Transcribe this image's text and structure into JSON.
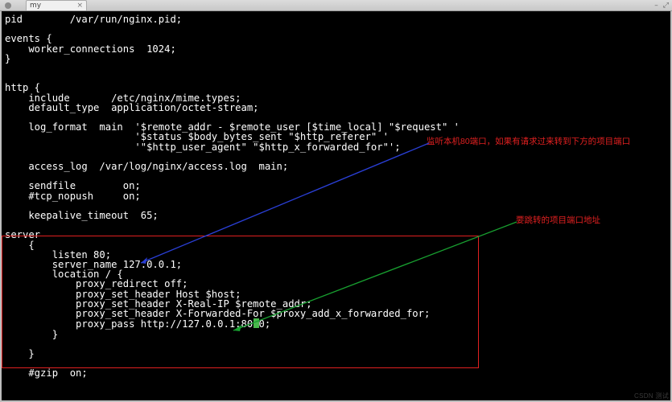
{
  "window": {
    "tab_title": "my",
    "close_glyph": "×",
    "right_icons": [
      "–",
      "⤢"
    ]
  },
  "code": {
    "l01": "pid        /var/run/nginx.pid;",
    "l02": "",
    "l03": "events {",
    "l04": "    worker_connections  1024;",
    "l05": "}",
    "l06": "",
    "l07": "",
    "l08": "http {",
    "l09": "    include       /etc/nginx/mime.types;",
    "l10": "    default_type  application/octet-stream;",
    "l11": "",
    "l12": "    log_format  main  '$remote_addr - $remote_user [$time_local] \"$request\" '",
    "l13": "                      '$status $body_bytes_sent \"$http_referer\" '",
    "l14": "                      '\"$http_user_agent\" \"$http_x_forwarded_for\"';",
    "l15": "",
    "l16": "    access_log  /var/log/nginx/access.log  main;",
    "l17": "",
    "l18": "    sendfile        on;",
    "l19": "    #tcp_nopush     on;",
    "l20": "",
    "l21": "    keepalive_timeout  65;",
    "l22": "",
    "l23": "server",
    "l24": "    {",
    "l25": "        listen 80;",
    "l26": "        server_name 127.0.0.1;",
    "l27": "        location / {",
    "l28": "            proxy_redirect off;",
    "l29": "            proxy_set_header Host $host;",
    "l30": "            proxy_set_header X-Real-IP $remote_addr;",
    "l31": "            proxy_set_header X-Forwarded-For $proxy_add_x_forwarded_for;",
    "l32_a": "            proxy_pass http://127.0.0.1:808",
    "l32_b": "0;",
    "l33": "        }",
    "l34": "",
    "l35": "    }",
    "l36": "",
    "l37": "    #gzip  on;"
  },
  "annotations": {
    "top": "监听本机80端口，如果有请求过来转到下方的项目端口",
    "bottom": "要跳转的项目端口地址"
  },
  "watermark": "CSDN 测试"
}
